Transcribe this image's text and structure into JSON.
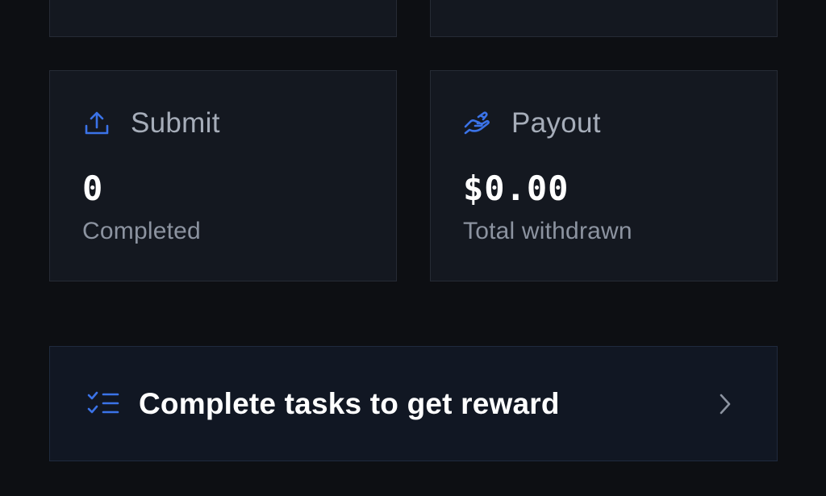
{
  "colors": {
    "background": "#0d0f13",
    "card": "#141820",
    "accent": "#3b73e8",
    "muted_text": "#a6adb9"
  },
  "cards": [
    {
      "icon": "upload-icon",
      "label": "Submit",
      "value": "0",
      "sub": "Completed"
    },
    {
      "icon": "hand-coin-icon",
      "label": "Payout",
      "value": "$0.00",
      "sub": "Total withdrawn"
    }
  ],
  "banner": {
    "icon": "checklist-icon",
    "text": "Complete tasks to get reward",
    "chevron": "chevron-right-icon"
  }
}
